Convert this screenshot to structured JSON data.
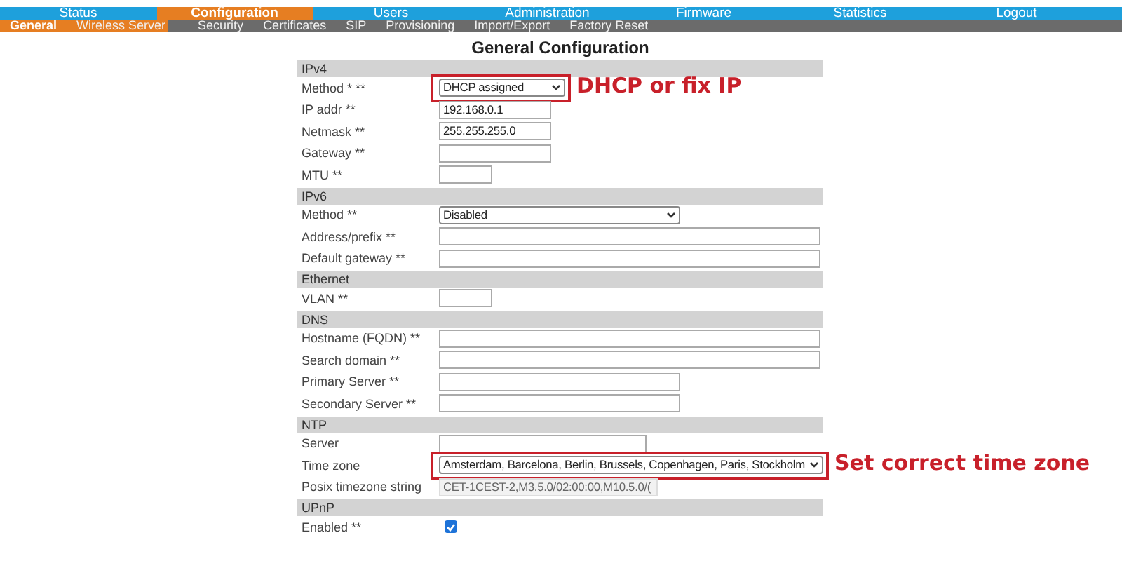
{
  "nav": {
    "tabs": [
      {
        "label": "Status",
        "selected": false
      },
      {
        "label": "Configuration",
        "selected": true
      },
      {
        "label": "Users",
        "selected": false
      },
      {
        "label": "Administration",
        "selected": false
      },
      {
        "label": "Firmware",
        "selected": false
      },
      {
        "label": "Statistics",
        "selected": false
      },
      {
        "label": "Logout",
        "selected": false
      }
    ]
  },
  "subnav": {
    "items": [
      {
        "label": "General",
        "selected": true
      },
      {
        "label": "Wireless Server",
        "selected": false
      },
      {
        "label": "Security",
        "selected": false
      },
      {
        "label": "Certificates",
        "selected": false
      },
      {
        "label": "SIP",
        "selected": false
      },
      {
        "label": "Provisioning",
        "selected": false
      },
      {
        "label": "Import/Export",
        "selected": false
      },
      {
        "label": "Factory Reset",
        "selected": false
      }
    ]
  },
  "form": {
    "title": "General Configuration",
    "sections": [
      {
        "heading": "IPv4",
        "rows": [
          {
            "label": "Method * **",
            "kind": "select",
            "value": "DHCP assigned",
            "callout": "DHCP or fix IP"
          },
          {
            "label": "IP addr **",
            "kind": "text",
            "value": "192.168.0.1"
          },
          {
            "label": "Netmask **",
            "kind": "text",
            "value": "255.255.255.0"
          },
          {
            "label": "Gateway **",
            "kind": "text"
          },
          {
            "label": "MTU **",
            "kind": "text"
          }
        ]
      },
      {
        "heading": "IPv6",
        "rows": [
          {
            "label": "Method **",
            "kind": "select",
            "value": "Disabled"
          },
          {
            "label": "Address/prefix **",
            "kind": "text"
          },
          {
            "label": "Default gateway **",
            "kind": "text"
          }
        ]
      },
      {
        "heading": "Ethernet",
        "rows": [
          {
            "label": "VLAN **",
            "kind": "text"
          }
        ]
      },
      {
        "heading": "DNS",
        "rows": [
          {
            "label": "Hostname (FQDN) **",
            "kind": "text"
          },
          {
            "label": "Search domain **",
            "kind": "text"
          },
          {
            "label": "Primary Server **",
            "kind": "text"
          },
          {
            "label": "Secondary Server **",
            "kind": "text"
          }
        ]
      },
      {
        "heading": "NTP",
        "rows": [
          {
            "label": "Server",
            "kind": "text"
          },
          {
            "label": "Time zone",
            "kind": "select",
            "value": "Amsterdam, Barcelona, Berlin, Brussels, Copenhagen, Paris, Stockholm",
            "callout": "Set correct time zone"
          },
          {
            "label": "Posix timezone string",
            "kind": "readonly",
            "value": "CET-1CEST-2,M3.5.0/02:00:00,M10.5.0/("
          }
        ]
      },
      {
        "heading": "UPnP",
        "rows": [
          {
            "label": "Enabled **",
            "kind": "checkbox",
            "checked": true
          }
        ]
      }
    ]
  }
}
